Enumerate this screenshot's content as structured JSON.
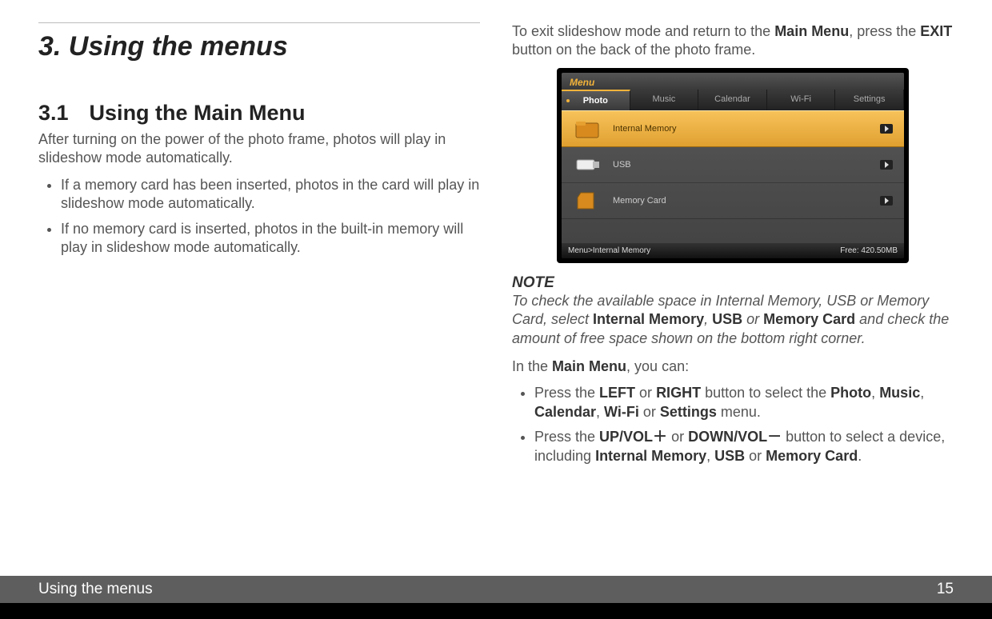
{
  "left": {
    "chapter_title": "3. Using the menus",
    "section_num": "3.1",
    "section_title": "Using the Main Menu",
    "intro": "After turning on the power of the photo frame, photos will play in slideshow mode automatically.",
    "bullets": [
      "If a memory card has been inserted, photos in the card will play in slideshow mode automatically.",
      "If no memory card is inserted, photos in the built-in memory will play in slideshow mode automatically."
    ]
  },
  "right": {
    "exit_pre": "To exit slideshow mode and return to the ",
    "exit_b1": "Main Menu",
    "exit_mid": ", press the ",
    "exit_b2": "EXIT",
    "exit_post": " button on the back of the photo frame.",
    "note_heading": "NOTE",
    "note_pre": "To check the available space in Internal Memory, USB or Memory Card, select ",
    "note_b1": "Internal Memory",
    "note_sep1": ", ",
    "note_b2": "USB",
    "note_or": " or ",
    "note_b3": "Memory Card",
    "note_post": " and check the amount of free space shown on the bottom right corner.",
    "inmenu_pre": "In the ",
    "inmenu_b": "Main Menu",
    "inmenu_post": ", you can:",
    "b1_pre": "Press the ",
    "b1_b1": "LEFT",
    "b1_or1": " or ",
    "b1_b2": "RIGHT",
    "b1_mid": " button to select the ",
    "b1_b3": "Photo",
    "b1_c1": ", ",
    "b1_b4": "Music",
    "b1_c2": ", ",
    "b1_b5": "Calendar",
    "b1_c3": ", ",
    "b1_b6": "Wi-Fi",
    "b1_or2": " or ",
    "b1_b7": "Settings",
    "b1_post": " menu.",
    "b2_pre": "Press the ",
    "b2_b1": "UP/VOL＋",
    "b2_or1": " or ",
    "b2_b2": "DOWN/VOL－",
    "b2_mid": " button to select a device, including ",
    "b2_b3": "Internal Memory",
    "b2_c1": ", ",
    "b2_b4": "USB",
    "b2_or2": " or ",
    "b2_b5": "Memory Card",
    "b2_post": "."
  },
  "screenshot": {
    "menu_label": "Menu",
    "tabs": [
      "Photo",
      "Music",
      "Calendar",
      "Wi-Fi",
      "Settings"
    ],
    "rows": [
      {
        "label": "Internal Memory",
        "selected": true
      },
      {
        "label": "USB",
        "selected": false
      },
      {
        "label": "Memory Card",
        "selected": false
      }
    ],
    "breadcrumb": "Menu>Internal Memory",
    "free": "Free: 420.50MB"
  },
  "footer": {
    "title": "Using the menus",
    "page": "15"
  }
}
